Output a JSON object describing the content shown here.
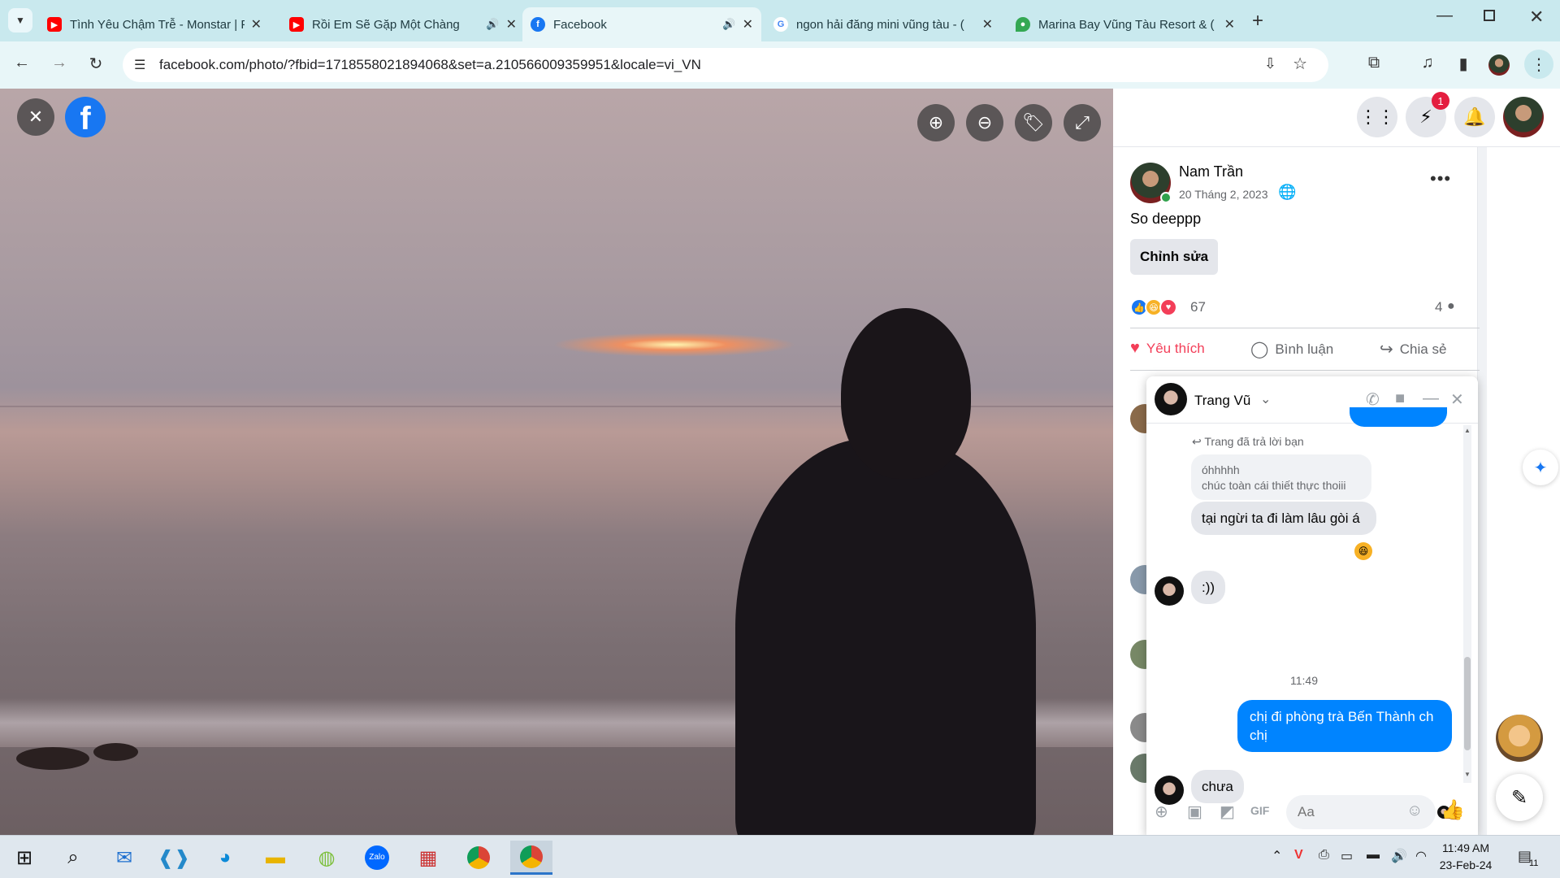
{
  "browser": {
    "tabs": [
      {
        "title": "Tình Yêu Chậm Trễ - Monstar | F",
        "favicon": "youtube-icon",
        "color": "#ff0000"
      },
      {
        "title": "Rồi Em Sẽ Gặp Một Chàng",
        "favicon": "youtube-icon",
        "color": "#ff0000"
      },
      {
        "title": "Facebook",
        "favicon": "facebook-icon",
        "color": "#1877f2"
      },
      {
        "title": "ngon hải đăng mini vũng tàu - (",
        "favicon": "google-icon",
        "color": "#4285f4"
      },
      {
        "title": "Marina Bay Vũng Tàu Resort & (",
        "favicon": "maps-icon",
        "color": "#34a853"
      }
    ],
    "url": "facebook.com/photo/?fbid=1718558021894068&set=a.210566009359951&locale=vi_VN"
  },
  "photo_viewer": {
    "zoom_in": "zoom-in-icon",
    "zoom_out": "zoom-out-icon",
    "tag": "tag-icon",
    "fullscreen": "fullscreen-icon"
  },
  "header": {
    "messenger_badge": "1"
  },
  "post": {
    "author": "Nam Trần",
    "date": "20 Tháng 2, 2023",
    "text": "So deeppp",
    "edit_label": "Chỉnh sửa",
    "reaction_count": "67",
    "comment_count": "4",
    "actions": {
      "like": "Yêu thích",
      "comment": "Bình luận",
      "share": "Chia sẻ"
    }
  },
  "chat": {
    "name": "Trang Vũ",
    "reply_note": "Trang đã trả lời bạn",
    "quoted_line1": "óhhhhh",
    "quoted_line2": "chúc toàn cái thiết thực thoiii",
    "msg1": "tại ngừi ta đi làm lâu gòi á",
    "msg2": ":))",
    "time": "11:49",
    "msg3": "chị đi phòng trà Bến Thành ch chị",
    "msg4": "chưa",
    "input_placeholder": "Aa"
  },
  "taskbar": {
    "time": "11:49 AM",
    "date": "23-Feb-24",
    "notif_count": "11"
  },
  "colors": {
    "accent": "#1877f2",
    "like_red": "#f33e58",
    "messenger_blue": "#0084ff"
  }
}
